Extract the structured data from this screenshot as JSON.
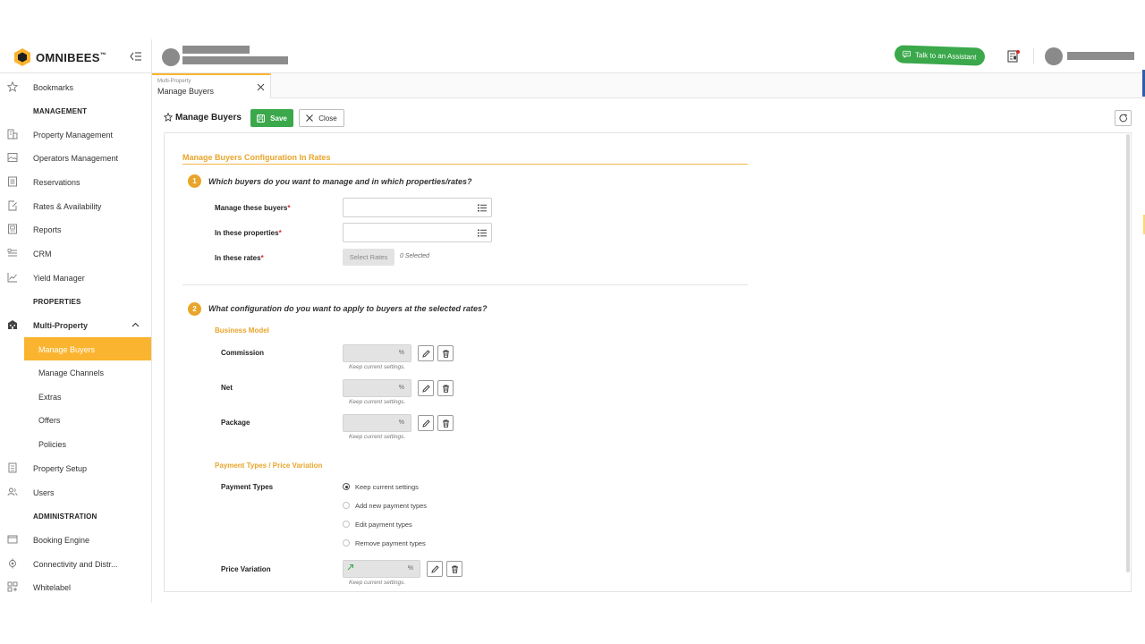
{
  "header": {
    "brand": "OMNIBEES",
    "brand_tm": "™",
    "assistant_label": "Talk to an Assistant"
  },
  "sidebar": {
    "items": [
      {
        "label": "Bookmarks",
        "icon": "star-icon"
      },
      {
        "label": "MANAGEMENT",
        "type": "heading"
      },
      {
        "label": "Property Management",
        "icon": "building-icon"
      },
      {
        "label": "Operators Management",
        "icon": "image-icon"
      },
      {
        "label": "Reservations",
        "icon": "list-doc-icon"
      },
      {
        "label": "Rates & Availability",
        "icon": "doc-edit-icon"
      },
      {
        "label": "Reports",
        "icon": "report-icon"
      },
      {
        "label": "CRM",
        "icon": "crm-icon"
      },
      {
        "label": "Yield Manager",
        "icon": "chart-line-icon"
      },
      {
        "label": "PROPERTIES",
        "type": "heading"
      },
      {
        "label": "Multi-Property",
        "icon": "multi-building-icon",
        "expanded": true
      },
      {
        "label": "Manage Buyers",
        "type": "sub",
        "active": true
      },
      {
        "label": "Manage Channels",
        "type": "sub"
      },
      {
        "label": "Extras",
        "type": "sub"
      },
      {
        "label": "Offers",
        "type": "sub"
      },
      {
        "label": "Policies",
        "type": "sub"
      },
      {
        "label": "Property Setup",
        "icon": "setup-icon"
      },
      {
        "label": "Users",
        "icon": "users-icon"
      },
      {
        "label": "ADMINISTRATION",
        "type": "heading"
      },
      {
        "label": "Booking Engine",
        "icon": "window-icon"
      },
      {
        "label": "Connectivity and Distr...",
        "icon": "connectivity-icon"
      },
      {
        "label": "Whitelabel",
        "icon": "grid-icon"
      }
    ]
  },
  "tab": {
    "parent": "Multi-Property",
    "title": "Manage Buyers"
  },
  "toolbar": {
    "title": "Manage Buyers",
    "save_label": "Save",
    "close_label": "Close"
  },
  "form": {
    "section_title": "Manage Buyers Configuration In Rates",
    "step1": {
      "number": "1",
      "question": "Which buyers do you want to manage and in which properties/rates?",
      "buyers_label": "Manage these buyers",
      "properties_label": "In these properties",
      "rates_label": "In these rates",
      "select_rates_label": "Select Rates",
      "selected_count": "0 Selected"
    },
    "step2": {
      "number": "2",
      "question": "What configuration do you want to apply to buyers at the selected rates?",
      "business_model_title": "Business Model",
      "commission_label": "Commission",
      "net_label": "Net",
      "package_label": "Package",
      "percent": "%",
      "keep_hint": "Keep current settings.",
      "payment_title": "Payment Types / Price Variation",
      "payment_types_label": "Payment Types",
      "payment_options": [
        {
          "label": "Keep current settings",
          "selected": true
        },
        {
          "label": "Add new payment types",
          "selected": false
        },
        {
          "label": "Edit payment types",
          "selected": false
        },
        {
          "label": "Remove payment types",
          "selected": false
        }
      ],
      "price_variation_label": "Price Variation"
    },
    "required_mark": "*"
  },
  "colors": {
    "accent": "#fbb42f",
    "accent_text": "#e9a52a",
    "success": "#3aa84b",
    "required": "#d9262b"
  }
}
